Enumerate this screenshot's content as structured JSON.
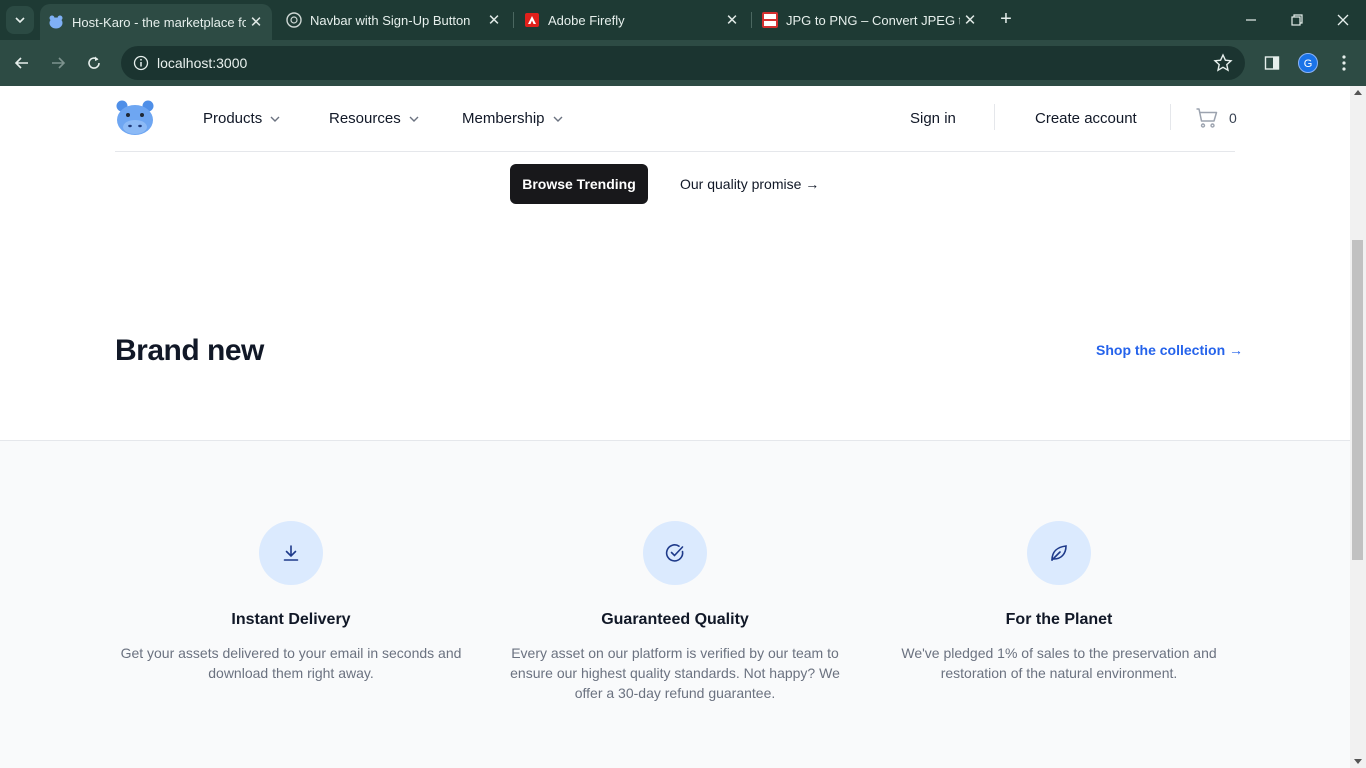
{
  "browser": {
    "tabs": [
      {
        "title": "Host-Karo - the marketplace fo",
        "active": true
      },
      {
        "title": "Navbar with Sign-Up Button",
        "active": false
      },
      {
        "title": "Adobe Firefly",
        "active": false
      },
      {
        "title": "JPG to PNG – Convert JPEG to P",
        "active": false
      }
    ],
    "address": "localhost:3000",
    "profile_initial": "G"
  },
  "site_nav": {
    "items": [
      {
        "label": "Products"
      },
      {
        "label": "Resources"
      },
      {
        "label": "Membership"
      }
    ],
    "sign_in": "Sign in",
    "create_account": "Create account",
    "cart_count": "0"
  },
  "hero": {
    "primary_button": "Browse Trending",
    "secondary_link": "Our quality promise →"
  },
  "brand_new": {
    "title": "Brand new",
    "link": "Shop the collection →"
  },
  "features": [
    {
      "icon": "download-icon",
      "title": "Instant Delivery",
      "text": "Get your assets delivered to your email in seconds and download them right away."
    },
    {
      "icon": "check-circle-icon",
      "title": "Guaranteed Quality",
      "text": "Every asset on our platform is verified by our team to ensure our highest quality standards. Not happy? We offer a 30-day refund guarantee."
    },
    {
      "icon": "leaf-icon",
      "title": "For the Planet",
      "text": "We've pledged 1% of sales to the preservation and restoration of the natural environment."
    }
  ],
  "colors": {
    "chrome_bg": "#1e3a34",
    "primary_button": "#18181b",
    "link": "#2563eb",
    "feature_icon_bg": "#dbeafe"
  }
}
